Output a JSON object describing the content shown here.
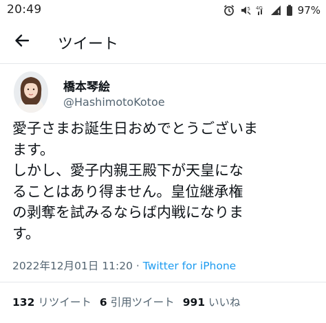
{
  "status_bar": {
    "time": "20:49",
    "battery": "97%",
    "icons": [
      "alarm-icon",
      "mute-vibrate-icon",
      "wifi-icon",
      "signal-icon",
      "battery-icon"
    ]
  },
  "header": {
    "back_icon": "arrow-left-icon",
    "title": "ツイート"
  },
  "tweet": {
    "display_name": "橋本琴絵",
    "handle": "@HashimotoKotoe",
    "text_lines": [
      "愛子さまお誕生日おめでとうございま",
      "ます。",
      "しかし、愛子内親王殿下が天皇にな",
      "ることはあり得ません。皇位継承権",
      "の剥奪を試みるならば内戦になりま",
      "す。"
    ],
    "timestamp": "2022年12月01日 11:20",
    "separator": " · ",
    "source": "Twitter for iPhone"
  },
  "stats": [
    {
      "count": "132",
      "label": "リツイート"
    },
    {
      "count": "6",
      "label": "引用ツイート"
    },
    {
      "count": "991",
      "label": "いいね"
    }
  ],
  "colors": {
    "text": "#0f1419",
    "secondary": "#536471",
    "link": "#1d9bf0",
    "divider": "#e4e7ea"
  }
}
